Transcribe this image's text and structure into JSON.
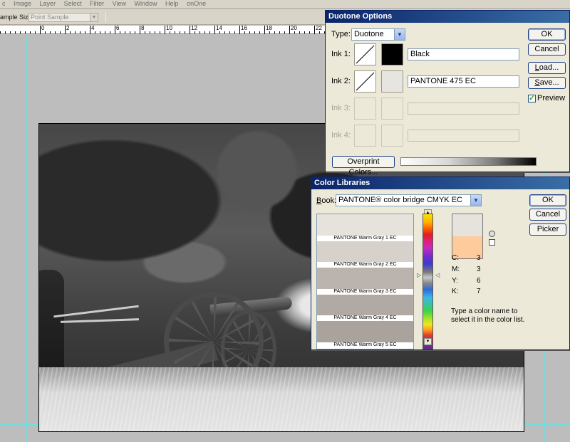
{
  "menubar": {
    "items": [
      "c",
      "Image",
      "Layer",
      "Select",
      "Filter",
      "View",
      "Window",
      "Help",
      "onOne"
    ]
  },
  "options_bar": {
    "sample_size_label": "ample Size:",
    "sample_size_value": "Point Sample"
  },
  "ruler": {
    "labels": [
      "0",
      "2",
      "4",
      "6",
      "8",
      "10",
      "12",
      "14",
      "16",
      "18",
      "20",
      "22"
    ]
  },
  "duotone_dialog": {
    "title": "Duotone Options",
    "type_label": "Type:",
    "type_value": "Duotone",
    "inks": [
      {
        "label": "Ink 1:",
        "name": "Black",
        "color": "#000000",
        "enabled": true
      },
      {
        "label": "Ink 2:",
        "name": "PANTONE 475 EC",
        "color": "#e6e5df",
        "enabled": true
      },
      {
        "label": "Ink 3:",
        "name": "",
        "color": "#ece9d8",
        "enabled": false
      },
      {
        "label": "Ink 4:",
        "name": "",
        "color": "#ece9d8",
        "enabled": false
      }
    ],
    "overprint_button": "Overprint Colors...",
    "ok_button": "OK",
    "cancel_button": "Cancel",
    "load_button": "Load...",
    "save_button": "Save...",
    "preview_label": "Preview",
    "preview_checked": true
  },
  "color_libraries_dialog": {
    "title": "Color Libraries",
    "book_label": "Book:",
    "book_value": "PANTONE® color bridge CMYK EC",
    "colors": [
      {
        "name": "PANTONE Warm Gray 1 EC",
        "hex": "#e5e3dc",
        "selected": true
      },
      {
        "name": "PANTONE Warm Gray 2 EC",
        "hex": "#d6d2cb",
        "selected": false
      },
      {
        "name": "PANTONE Warm Gray 3 EC",
        "hex": "#bbb3ad",
        "selected": false
      },
      {
        "name": "PANTONE Warm Gray 4 EC",
        "hex": "#b1a9a4",
        "selected": false
      },
      {
        "name": "PANTONE Warm Gray 5 EC",
        "hex": "#a9a29d",
        "selected": false
      }
    ],
    "preview_new_color": "#e5e3dc",
    "preview_old_color": "#fdcb9c",
    "cmyk": [
      {
        "label": "C:",
        "value": "3"
      },
      {
        "label": "M:",
        "value": "3"
      },
      {
        "label": "Y:",
        "value": "6"
      },
      {
        "label": "K:",
        "value": "7"
      }
    ],
    "hint": "Type a color name to select it in the color list.",
    "ok_button": "OK",
    "cancel_button": "Cancel",
    "picker_button": "Picker"
  }
}
